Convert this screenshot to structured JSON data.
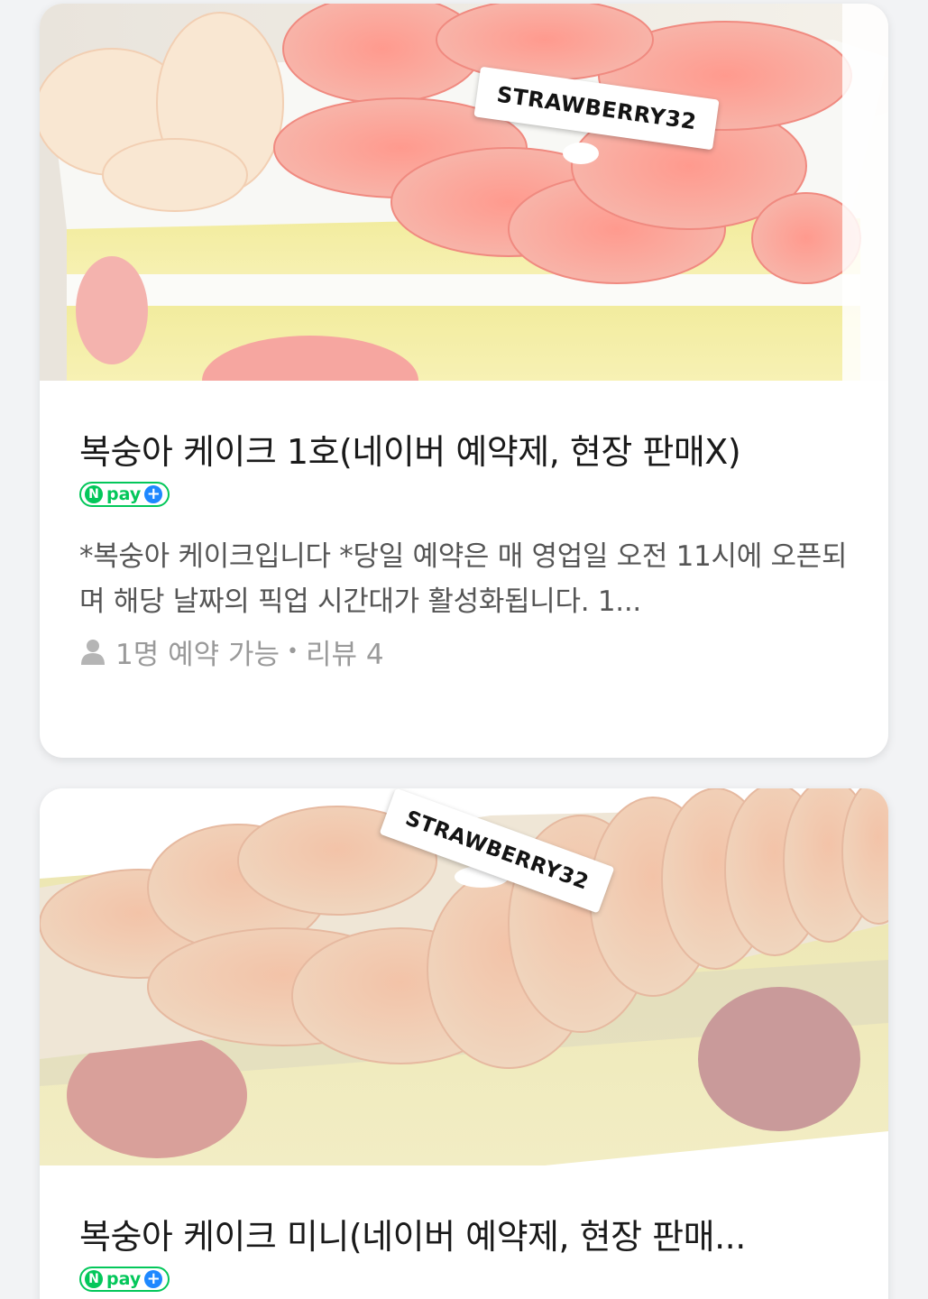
{
  "products": [
    {
      "photo_label": "STRAWBERRY32",
      "title": "복숭아 케이크 1호(네이버 예약제, 현장 판매X)",
      "badge": {
        "n": "N",
        "text": "pay",
        "plus": "+"
      },
      "description": "*복숭아 케이크입니다 *당일 예약은 매 영업일 오전 11시에 오픈되며 해당 날짜의 픽업 시간대가 활성화됩니다. 1...",
      "availability": "1명 예약 가능",
      "separator": "•",
      "reviews": "리뷰 4"
    },
    {
      "photo_label": "STRAWBERRY32",
      "title": "복숭아 케이크 미니(네이버 예약제, 현장 판매...",
      "badge": {
        "n": "N",
        "text": "pay",
        "plus": "+"
      }
    }
  ],
  "colors": {
    "npay_green": "#03c75a",
    "npay_blue": "#1e88ff",
    "background": "#f2f3f5"
  },
  "icons": {
    "person": "person-icon",
    "npay": "npay-plus-icon"
  }
}
